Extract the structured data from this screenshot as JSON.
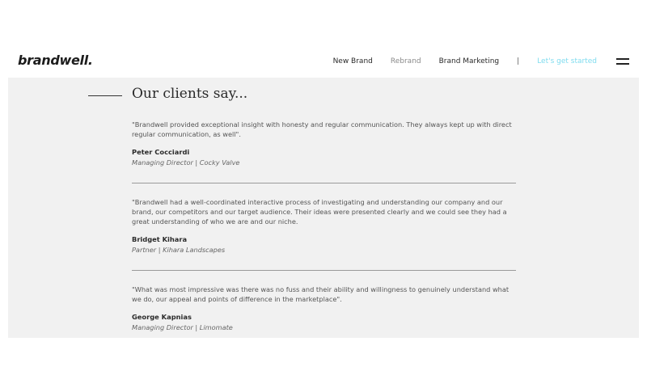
{
  "header": {
    "logo": "brandwell.",
    "nav": [
      {
        "label": "New Brand"
      },
      {
        "label": "Rebrand"
      },
      {
        "label": "Brand Marketing"
      }
    ],
    "separator": "|",
    "cta": "Let's get started",
    "menu_icon": "hamburger-menu-icon"
  },
  "section": {
    "title": "Our clients say...",
    "testimonials": [
      {
        "quote": "\"Brandwell provided exceptional insight with honesty and regular communication. They always kept up with direct regular communication, as well\".",
        "author": "Peter Cocciardi",
        "role": "Managing Director | Cocky Valve"
      },
      {
        "quote": "\"Brandwell had a well-coordinated interactive process of investigating and understanding our company and our brand, our competitors and our target audience. Their ideas were presented clearly and we could see they had a great understanding of who we are and our niche.",
        "author": "Bridget Kihara",
        "role": "Partner | Kihara Landscapes"
      },
      {
        "quote": "\"What was most impressive was there was no fuss and their ability and willingness to genuinely understand what we do, our appeal and points of difference in the marketplace\".",
        "author": "George Kapnias",
        "role": "Managing Director | Limomate"
      }
    ]
  },
  "colors": {
    "section_bg": "#f1f1f1",
    "cta": "#7fdcef",
    "text": "#2a2a2a"
  }
}
